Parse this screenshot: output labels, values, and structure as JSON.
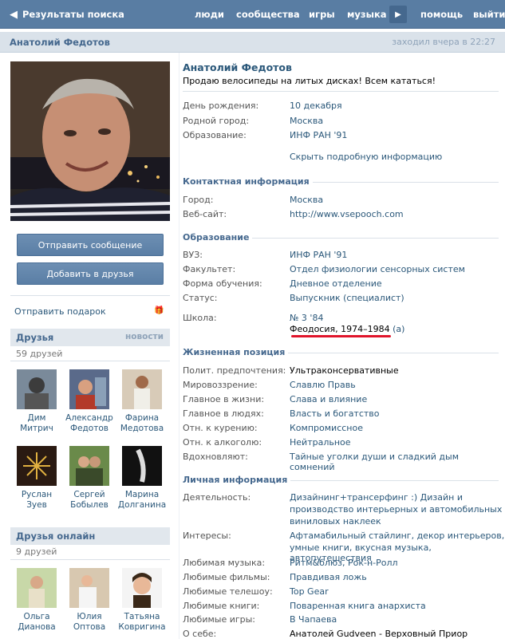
{
  "topbar": {
    "back_label": "Результаты поиска",
    "nav": [
      "люди",
      "сообщества",
      "игры",
      "музыка",
      "помощь",
      "выйти"
    ]
  },
  "title": {
    "name": "Анатолий Федотов",
    "last_seen": "заходил вчера в 22:27"
  },
  "profile": {
    "name": "Анатолий Федотов",
    "status": "Продаю велосипеды на литых дисках! Всем кататься!",
    "send_message": "Отправить сообщение",
    "add_friend": "Добавить в друзья",
    "gift": "Отправить подарок"
  },
  "basic": [
    {
      "k": "День рождения:",
      "v": "10 декабря"
    },
    {
      "k": "Родной город:",
      "v": "Москва"
    },
    {
      "k": "Образование:",
      "v": "ИНФ РАН '91"
    }
  ],
  "hide_info": "Скрыть подробную информацию",
  "contact": {
    "title": "Контактная информация",
    "rows": [
      {
        "k": "Город:",
        "v": "Москва"
      },
      {
        "k": "Веб-сайт:",
        "v": "http://www.vsepooch.com"
      }
    ]
  },
  "education": {
    "title": "Образование",
    "rows": [
      {
        "k": "ВУЗ:",
        "v": "ИНФ РАН '91"
      },
      {
        "k": "Факультет:",
        "v": "Отдел физиологии сенсорных систем"
      },
      {
        "k": "Форма обучения:",
        "v": "Дневное отделение"
      },
      {
        "k": "Статус:",
        "v": "Выпускник (специалист)"
      }
    ],
    "school_k": "Школа:",
    "school_v": "№ 3 '84",
    "school_detail": "Феодосия, 1974–1984",
    "school_a": "(а)"
  },
  "position": {
    "title": "Жизненная позиция",
    "rows": [
      {
        "k": "Полит. предпочтения:",
        "v": "Ультраконсервативные"
      },
      {
        "k": "Мировоззрение:",
        "v": "Славлю Правь"
      },
      {
        "k": "Главное в жизни:",
        "v": "Слава и влияние"
      },
      {
        "k": "Главное в людях:",
        "v": "Власть и богатство"
      },
      {
        "k": "Отн. к курению:",
        "v": "Компромиссное"
      },
      {
        "k": "Отн. к алкоголю:",
        "v": "Нейтральное"
      },
      {
        "k": "Вдохновляют:",
        "v": "Тайные уголки души и сладкий дым сомнений"
      }
    ]
  },
  "personal": {
    "title": "Личная информация",
    "activity_k": "Деятельность:",
    "activity_v": [
      "Дизайнинг+трансерфинг :) Дизайн и",
      "производство интерьерных и автомобильных",
      "виниловых наклеек"
    ],
    "interests_k": "Интересы:",
    "interests_v": [
      "Афтамабильный стайлинг, декор интерьеров,",
      "умные книги, вкусная музыка, автопутешествия"
    ],
    "rows": [
      {
        "k": "Любимая музыка:",
        "v": "Ритм&блюз, Рок-н-Ролл"
      },
      {
        "k": "Любимые фильмы:",
        "v": "Правдивая ложь"
      },
      {
        "k": "Любимые телешоу:",
        "v": "Top Gear"
      },
      {
        "k": "Любимые книги:",
        "v": "Поваренная книга анархиста"
      },
      {
        "k": "Любимые игры:",
        "v": "В Чапаева"
      },
      {
        "k": "О себе:",
        "v": "Анатолей Gudveen - Верховный Приор Ордена"
      }
    ]
  },
  "friends": {
    "title": "Друзья",
    "news": "новости",
    "count": "59 друзей",
    "list": [
      {
        "first": "Дим",
        "last": "Митрич"
      },
      {
        "first": "Александр",
        "last": "Федотов"
      },
      {
        "first": "Фарина",
        "last": "Медотова"
      },
      {
        "first": "Руслан",
        "last": "Зуев"
      },
      {
        "first": "Сергей",
        "last": "Бобылев"
      },
      {
        "first": "Марина",
        "last": "Долганина"
      }
    ]
  },
  "online": {
    "title": "Друзья онлайн",
    "count": "9 друзей",
    "list": [
      {
        "first": "Ольга",
        "last": "Дианова"
      },
      {
        "first": "Юлия",
        "last": "Оптова"
      },
      {
        "first": "Татьяна",
        "last": "Ковригина"
      }
    ]
  }
}
